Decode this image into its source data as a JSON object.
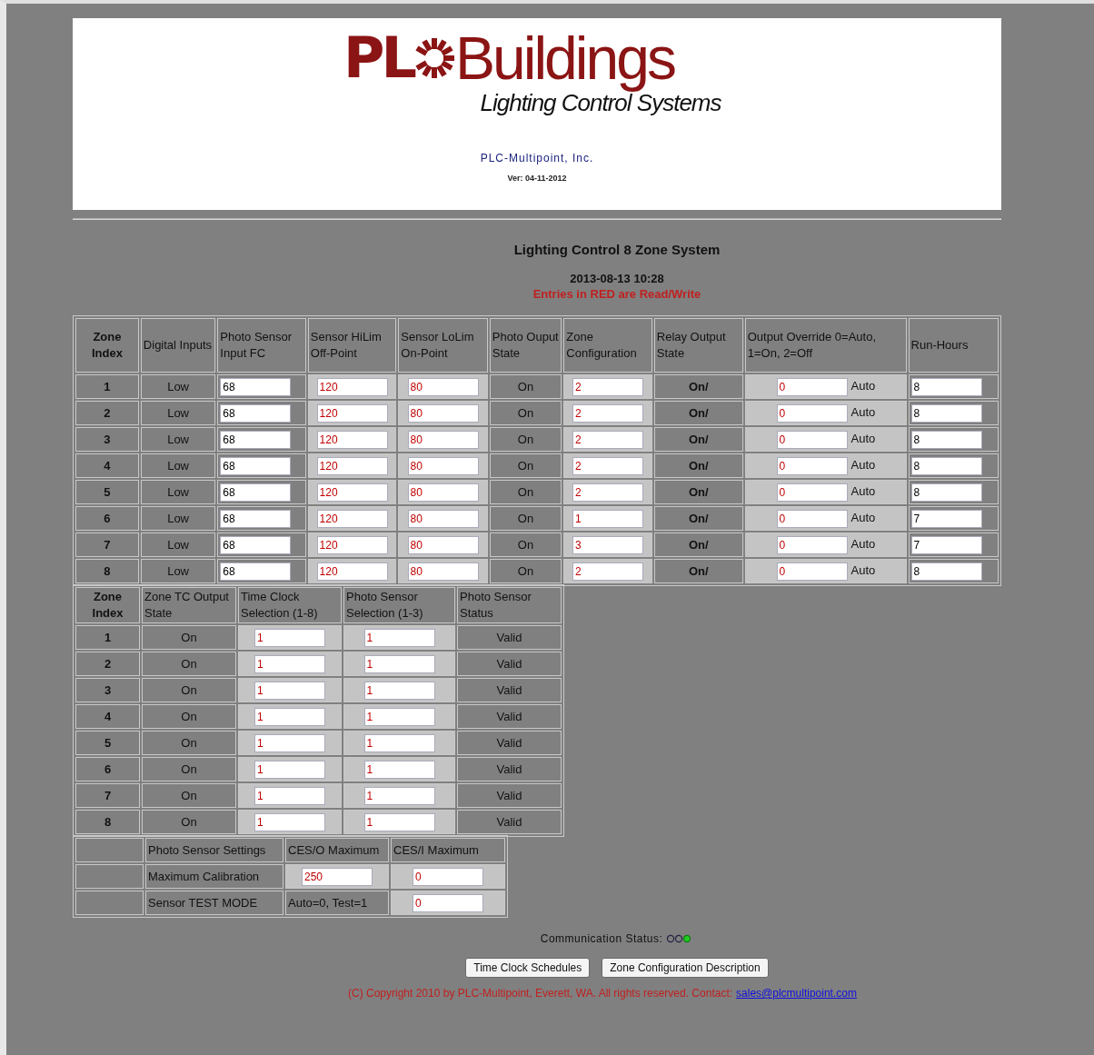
{
  "header": {
    "logo_a": "PL",
    "logo_b": "Buildings",
    "tagline": "Lighting Control Systems",
    "company": "PLC-Multipoint, Inc.",
    "version": "Ver: 04-11-2012"
  },
  "title": "Lighting Control 8 Zone System",
  "datetime": "2013-08-13 10:28",
  "note": "Entries in RED are Read/Write",
  "zone_table": {
    "columns": [
      "Zone Index",
      "Digital Inputs",
      "Photo Sensor Input FC",
      "Sensor HiLim Off-Point",
      "Sensor LoLim On-Point",
      "Photo Ouput State",
      "Zone Configuration",
      "Relay Output State",
      "Output Override 0=Auto, 1=On, 2=Off",
      "Run-Hours"
    ],
    "rows": [
      {
        "index": "1",
        "digital": "Low",
        "photo_fc": "68",
        "hilim": "120",
        "lolim": "80",
        "photo_state": "On",
        "config": "2",
        "relay": "On/",
        "override": "0",
        "override_label": "Auto",
        "run_hours": "8"
      },
      {
        "index": "2",
        "digital": "Low",
        "photo_fc": "68",
        "hilim": "120",
        "lolim": "80",
        "photo_state": "On",
        "config": "2",
        "relay": "On/",
        "override": "0",
        "override_label": "Auto",
        "run_hours": "8"
      },
      {
        "index": "3",
        "digital": "Low",
        "photo_fc": "68",
        "hilim": "120",
        "lolim": "80",
        "photo_state": "On",
        "config": "2",
        "relay": "On/",
        "override": "0",
        "override_label": "Auto",
        "run_hours": "8"
      },
      {
        "index": "4",
        "digital": "Low",
        "photo_fc": "68",
        "hilim": "120",
        "lolim": "80",
        "photo_state": "On",
        "config": "2",
        "relay": "On/",
        "override": "0",
        "override_label": "Auto",
        "run_hours": "8"
      },
      {
        "index": "5",
        "digital": "Low",
        "photo_fc": "68",
        "hilim": "120",
        "lolim": "80",
        "photo_state": "On",
        "config": "2",
        "relay": "On/",
        "override": "0",
        "override_label": "Auto",
        "run_hours": "8"
      },
      {
        "index": "6",
        "digital": "Low",
        "photo_fc": "68",
        "hilim": "120",
        "lolim": "80",
        "photo_state": "On",
        "config": "1",
        "relay": "On/",
        "override": "0",
        "override_label": "Auto",
        "run_hours": "7"
      },
      {
        "index": "7",
        "digital": "Low",
        "photo_fc": "68",
        "hilim": "120",
        "lolim": "80",
        "photo_state": "On",
        "config": "3",
        "relay": "On/",
        "override": "0",
        "override_label": "Auto",
        "run_hours": "7"
      },
      {
        "index": "8",
        "digital": "Low",
        "photo_fc": "68",
        "hilim": "120",
        "lolim": "80",
        "photo_state": "On",
        "config": "2",
        "relay": "On/",
        "override": "0",
        "override_label": "Auto",
        "run_hours": "8"
      }
    ]
  },
  "tc_table": {
    "columns": [
      "Zone Index",
      "Zone TC Output State",
      "Time Clock Selection (1-8)",
      "Photo Sensor Selection (1-3)",
      "Photo Sensor Status"
    ],
    "rows": [
      {
        "index": "1",
        "tc_state": "On",
        "tc_sel": "1",
        "ps_sel": "1",
        "status": "Valid"
      },
      {
        "index": "2",
        "tc_state": "On",
        "tc_sel": "1",
        "ps_sel": "1",
        "status": "Valid"
      },
      {
        "index": "3",
        "tc_state": "On",
        "tc_sel": "1",
        "ps_sel": "1",
        "status": "Valid"
      },
      {
        "index": "4",
        "tc_state": "On",
        "tc_sel": "1",
        "ps_sel": "1",
        "status": "Valid"
      },
      {
        "index": "5",
        "tc_state": "On",
        "tc_sel": "1",
        "ps_sel": "1",
        "status": "Valid"
      },
      {
        "index": "6",
        "tc_state": "On",
        "tc_sel": "1",
        "ps_sel": "1",
        "status": "Valid"
      },
      {
        "index": "7",
        "tc_state": "On",
        "tc_sel": "1",
        "ps_sel": "1",
        "status": "Valid"
      },
      {
        "index": "8",
        "tc_state": "On",
        "tc_sel": "1",
        "ps_sel": "1",
        "status": "Valid"
      }
    ]
  },
  "sensor_table": {
    "columns": [
      "Photo Sensor Settings",
      "CES/O Maximum",
      "CES/I Maximum"
    ],
    "rows": [
      {
        "cells": [
          {
            "kind": "text",
            "value": "Maximum Calibration"
          },
          {
            "kind": "input",
            "value": "250"
          },
          {
            "kind": "input",
            "value": "0"
          }
        ]
      },
      {
        "cells": [
          {
            "kind": "text",
            "value": "Sensor TEST MODE"
          },
          {
            "kind": "text",
            "value": "Auto=0, Test=1"
          },
          {
            "kind": "input",
            "value": "0"
          }
        ]
      }
    ]
  },
  "communication": {
    "label": "Communication Status:",
    "lights": [
      {
        "on": false
      },
      {
        "on": false
      },
      {
        "on": true
      }
    ]
  },
  "buttons": [
    "Time Clock Schedules",
    "Zone Configuration Description"
  ],
  "footer": {
    "copyright": "(C) Copyright 2010 by PLC-Multipoint, Everett, WA. All rights reserved. Contact:",
    "email": "sales@plcmultipoint.com"
  }
}
